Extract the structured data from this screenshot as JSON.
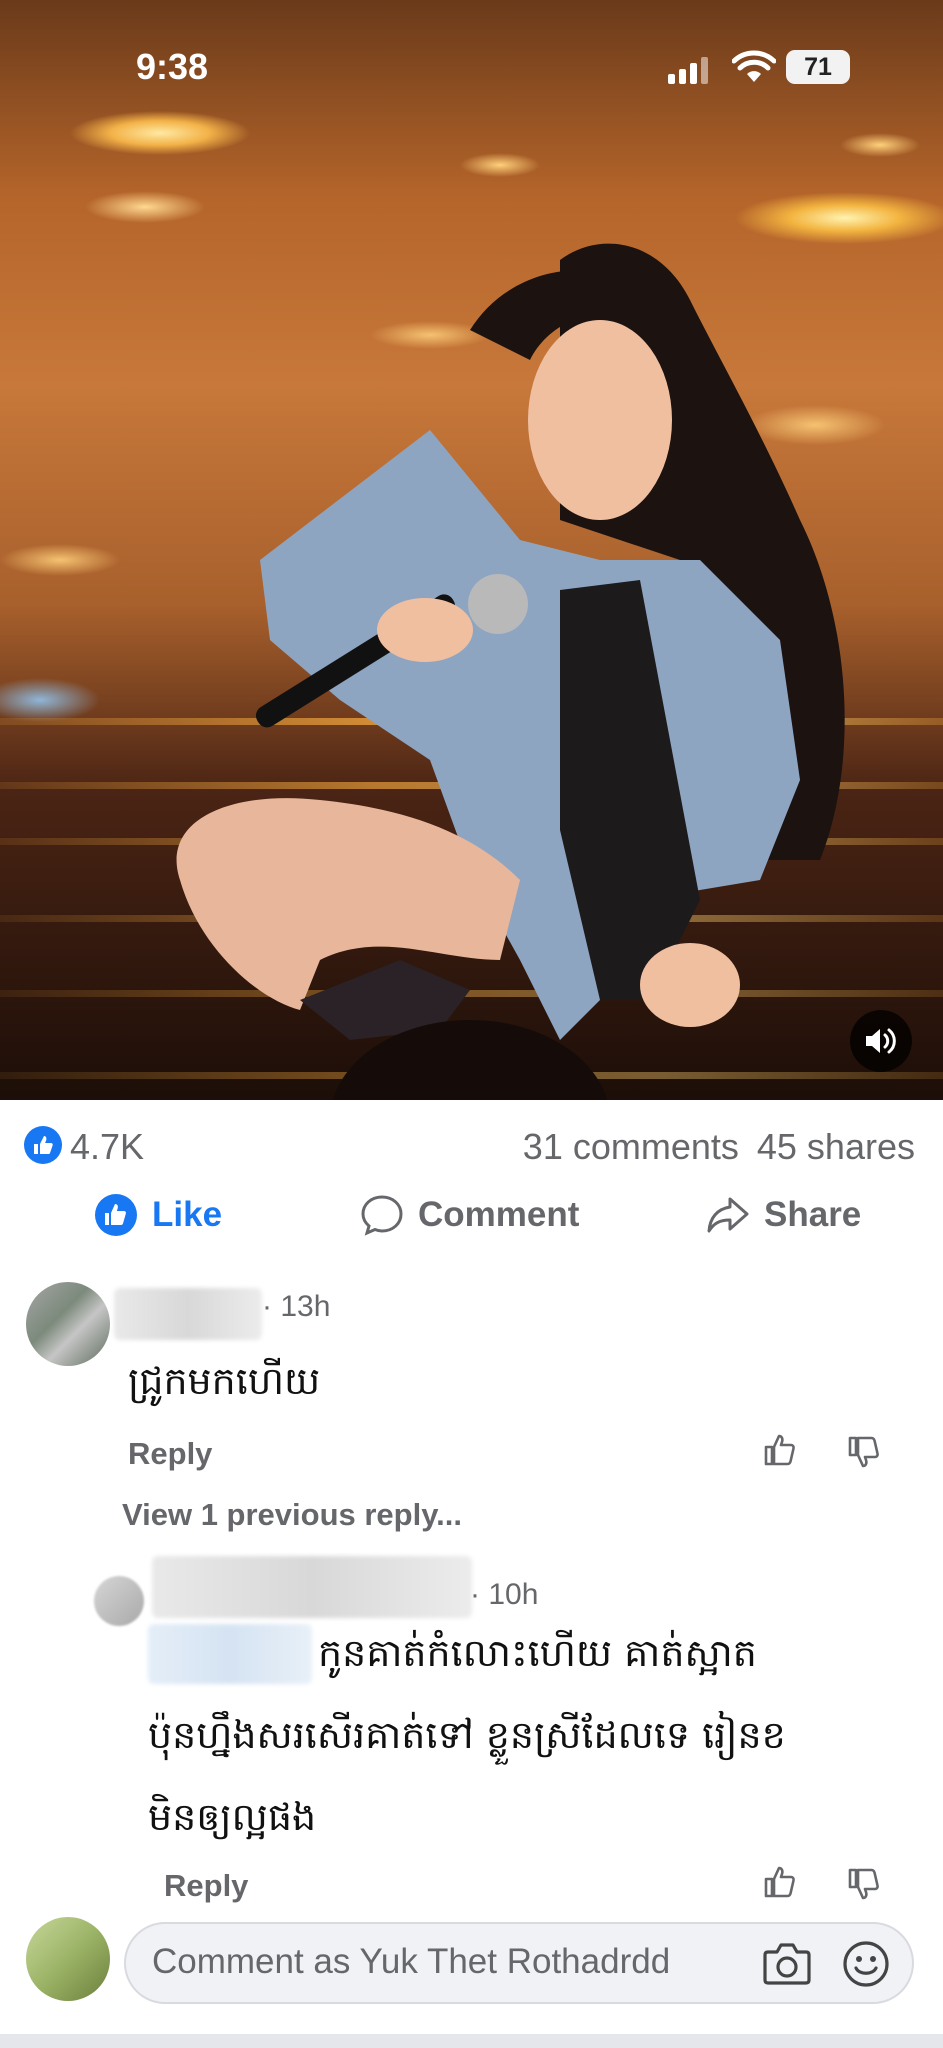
{
  "status_bar": {
    "time": "9:38",
    "battery": "71"
  },
  "post": {
    "reaction_count": "4.7K",
    "comments_count": "31 comments",
    "shares_count": "45 shares",
    "actions": {
      "like": "Like",
      "comment": "Comment",
      "share": "Share"
    }
  },
  "comments": [
    {
      "time": "13h",
      "text": "ជ្រូកមកហើយ",
      "reply_label": "Reply"
    }
  ],
  "view_previous": "View 1 previous reply...",
  "reply": {
    "time": "10h",
    "text_lines": [
      "កូនគាត់កំលោះហើយ គាត់ស្អាត",
      "ប៉ុនហ្នឹងសរសើរគាត់ទៅ ខ្លួនស្រីដែលទេ រៀនខ",
      "មិនឲ្យល្អផង"
    ],
    "reply_label": "Reply"
  },
  "composer": {
    "placeholder": "Comment as Yuk Thet Rothadrdd"
  },
  "colors": {
    "accent": "#1877f2",
    "secondary_text": "#65676b"
  }
}
